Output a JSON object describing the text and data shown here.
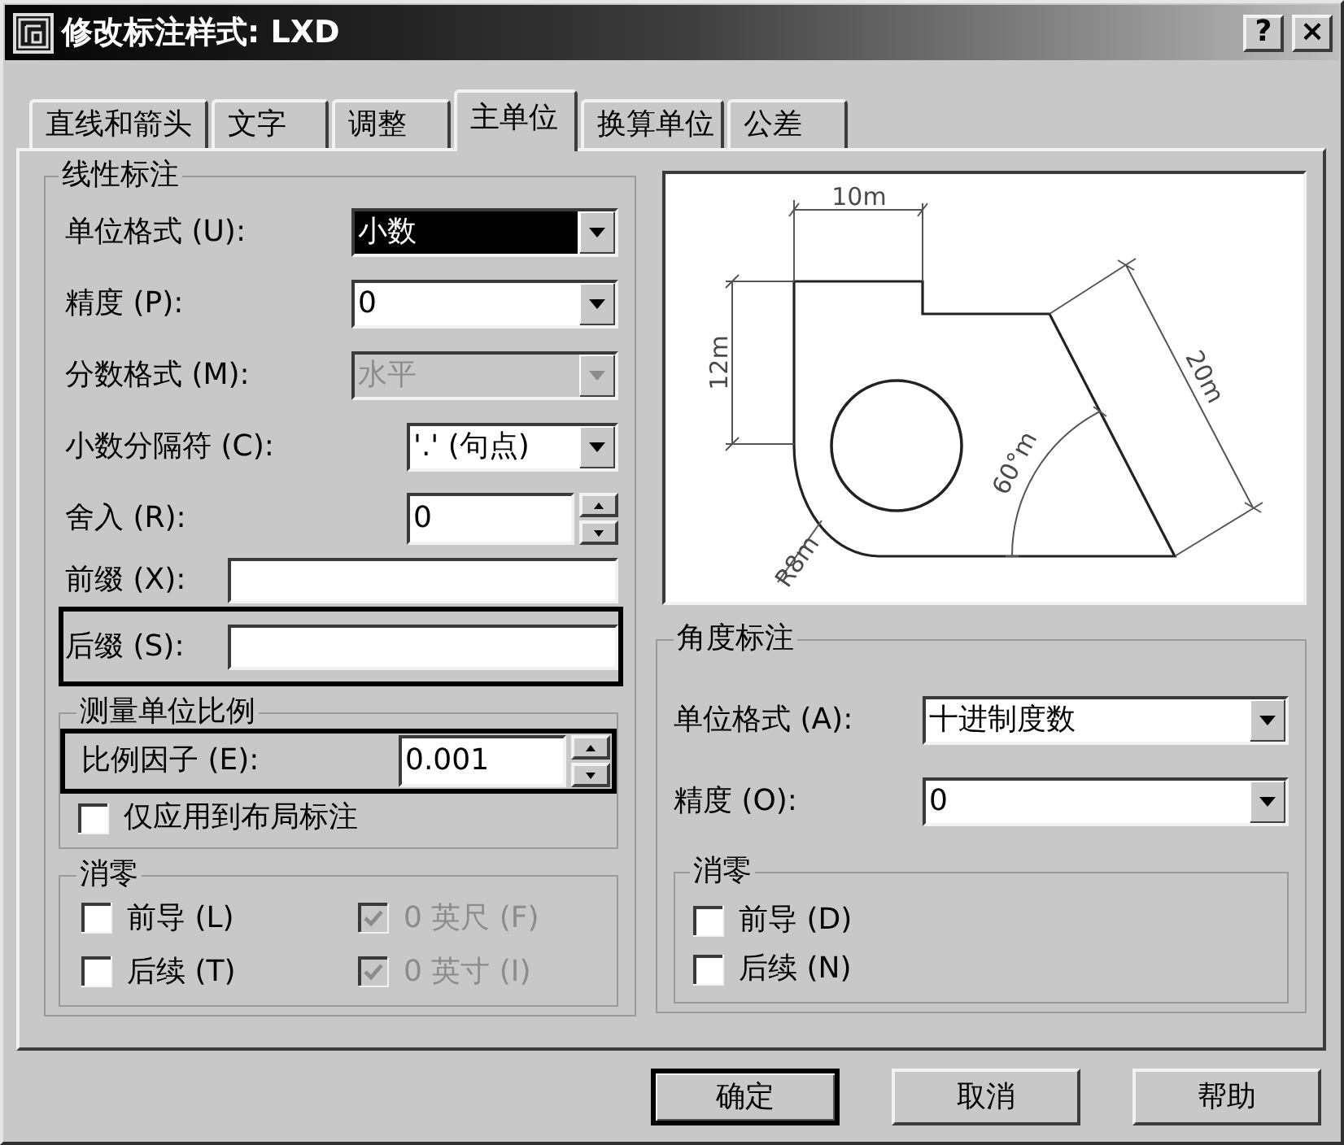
{
  "window": {
    "title": "修改标注样式: LXD",
    "controls": [
      "?",
      "×"
    ]
  },
  "tabs": [
    {
      "label": "直线和箭头",
      "selected": false
    },
    {
      "label": "文字",
      "selected": false
    },
    {
      "label": "调整",
      "selected": false
    },
    {
      "label": "主单位",
      "selected": true
    },
    {
      "label": "换算单位",
      "selected": false
    },
    {
      "label": "公差",
      "selected": false
    }
  ],
  "linear_dimensions": {
    "title": "线性标注",
    "fields": [
      {
        "kind": "dropdown",
        "label": "单位格式 (U):",
        "value": "小数",
        "value_selected": true,
        "disabled": false,
        "outlined": false
      },
      {
        "kind": "dropdown",
        "label": "精度 (P):",
        "value": "0",
        "value_selected": false,
        "disabled": false,
        "outlined": false
      },
      {
        "kind": "dropdown",
        "label": "分数格式 (M):",
        "value": "水平",
        "value_selected": false,
        "disabled": true,
        "outlined": false
      },
      {
        "kind": "dropdown",
        "label": "小数分隔符 (C):",
        "value": "'.' (句点)",
        "value_selected": false,
        "disabled": false,
        "outlined": false
      },
      {
        "kind": "spinner",
        "label": "舍入 (R):",
        "value": "0",
        "disabled": false,
        "outlined": false
      },
      {
        "kind": "text",
        "label": "前缀 (X):",
        "disabled": false,
        "outlined": false
      },
      {
        "kind": "text",
        "label": "后缀 (S):",
        "disabled": false,
        "outlined": true
      }
    ],
    "scale": {
      "title": "测量单位比例",
      "factor": {
        "label": "比例因子 (E):",
        "value": "0.001",
        "outlined": true
      },
      "layout_only": {
        "label": "仅应用到布局标注",
        "checked": false
      }
    },
    "zero_suppression": {
      "title": "消零",
      "options": [
        {
          "label": "前导 (L)",
          "checked": false,
          "disabled": false
        },
        {
          "label": "0 英尺 (F)",
          "checked": true,
          "disabled": true
        },
        {
          "label": "后续 (T)",
          "checked": false,
          "disabled": false
        },
        {
          "label": "0 英寸 (I)",
          "checked": true,
          "disabled": true
        }
      ]
    }
  },
  "preview": {
    "labels": [
      "10m",
      "12m",
      "20m",
      "60°m",
      "R8m"
    ]
  },
  "angular_dimensions": {
    "title": "角度标注",
    "fields": [
      {
        "kind": "dropdown",
        "label": "单位格式 (A):",
        "value": "十进制度数"
      },
      {
        "kind": "dropdown",
        "label": "精度 (O):",
        "value": "0"
      }
    ],
    "zero_suppression": {
      "title": "消零",
      "options": [
        {
          "label": "前导 (D)",
          "checked": false
        },
        {
          "label": "后续 (N)",
          "checked": false
        }
      ]
    }
  },
  "buttons": [
    {
      "label": "确定",
      "default": true
    },
    {
      "label": "取消",
      "default": false
    },
    {
      "label": "帮助",
      "default": false
    }
  ]
}
